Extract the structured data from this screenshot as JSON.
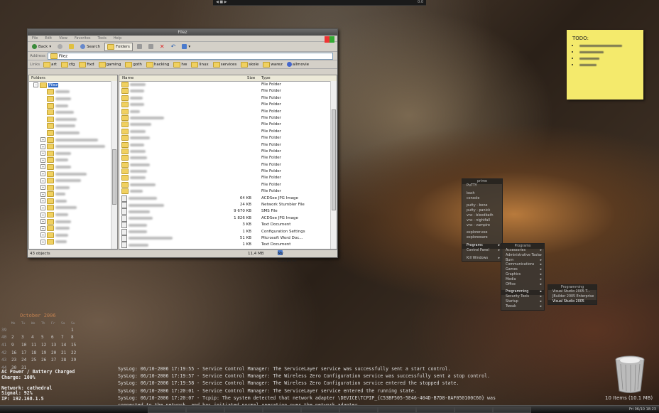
{
  "topbar": {
    "left_text": "",
    "right_text": "0:0"
  },
  "window": {
    "title": "Filez",
    "menu": [
      "File",
      "Edit",
      "View",
      "Favorites",
      "Tools",
      "Help"
    ],
    "toolbar": {
      "back": "Back",
      "search": "Search",
      "folders": "Folders"
    },
    "address_label": "Address",
    "address_value": "Filez",
    "links_label": "Links",
    "links": [
      "art",
      "cfg",
      "fixd",
      "gaming",
      "goth",
      "hacking",
      "hw",
      "linux",
      "services",
      "skole",
      "warez",
      "allmovie"
    ],
    "folders_header": "Folders",
    "tree_root": "Filez",
    "columns": {
      "name": "Name",
      "size": "Size",
      "type": "Type"
    },
    "files": [
      {
        "size": "",
        "type": "File Folder"
      },
      {
        "size": "",
        "type": "File Folder"
      },
      {
        "size": "",
        "type": "File Folder"
      },
      {
        "size": "",
        "type": "File Folder"
      },
      {
        "size": "",
        "type": "File Folder"
      },
      {
        "size": "",
        "type": "File Folder"
      },
      {
        "size": "",
        "type": "File Folder"
      },
      {
        "size": "",
        "type": "File Folder"
      },
      {
        "size": "",
        "type": "File Folder"
      },
      {
        "size": "",
        "type": "File Folder"
      },
      {
        "size": "",
        "type": "File Folder"
      },
      {
        "size": "",
        "type": "File Folder"
      },
      {
        "size": "",
        "type": "File Folder"
      },
      {
        "size": "",
        "type": "File Folder"
      },
      {
        "size": "",
        "type": "File Folder"
      },
      {
        "size": "",
        "type": "File Folder"
      },
      {
        "size": "",
        "type": "File Folder"
      },
      {
        "size": "64 KB",
        "type": "ACDSee JPG Image"
      },
      {
        "size": "24 KB",
        "type": "Network Stumbler File"
      },
      {
        "size": "9 670 KB",
        "type": "SMS File"
      },
      {
        "size": "1 826 KB",
        "type": "ACDSee JPG Image"
      },
      {
        "size": "3 KB",
        "type": "Text Document"
      },
      {
        "size": "1 KB",
        "type": "Configuration Settings"
      },
      {
        "size": "51 KB",
        "type": "Microsoft Word Doc..."
      },
      {
        "size": "1 KB",
        "type": "Text Document"
      }
    ],
    "status": {
      "objects": "43 objects",
      "size": "11,4 MB",
      "location": "My Computer"
    }
  },
  "sticky": {
    "title": "TODO:"
  },
  "menu1": {
    "header": "prime",
    "items": [
      "PuTTY",
      "",
      "bash",
      "console",
      "",
      "putty - bone",
      "putty - panick",
      "vnc - bloodbath",
      "vnc - nightfall",
      "vnc - vampire",
      "",
      "explorer.exe",
      "exploreware",
      "",
      "Programs",
      "Control Panel",
      "",
      "Kill Windows"
    ]
  },
  "menu2": {
    "header": "Programs",
    "items": [
      "Accessories",
      "Administrative Tools",
      "Burn",
      "Communications",
      "Games",
      "Graphics",
      "Media",
      "Office",
      "",
      "Programming",
      "Security Tools",
      "Startup",
      "Tweak"
    ]
  },
  "menu3": {
    "header": "Programming",
    "items": [
      "Visual Studio 2005 T...",
      "JBuilder 2005 Enterprise",
      "Visual Studio 2005"
    ]
  },
  "calendar": {
    "title": "October 2006",
    "days": [
      "Mo",
      "Tu",
      "We",
      "Th",
      "Fr",
      "Sa",
      "Su"
    ],
    "weeks": [
      [
        "39",
        "",
        "",
        "",
        "",
        "",
        "",
        "1"
      ],
      [
        "40",
        "2",
        "3",
        "4",
        "5",
        "6",
        "7",
        "8"
      ],
      [
        "41",
        "9",
        "10",
        "11",
        "12",
        "13",
        "14",
        "15"
      ],
      [
        "42",
        "16",
        "17",
        "18",
        "19",
        "20",
        "21",
        "22"
      ],
      [
        "43",
        "23",
        "24",
        "25",
        "26",
        "27",
        "28",
        "29"
      ],
      [
        "44",
        "30",
        "31",
        "",
        "",
        "",
        "",
        ""
      ]
    ]
  },
  "sysinfo": [
    "AC Power / Battery Charged",
    "Charge: 100%",
    "",
    "Network: cathedral",
    "Signal: 92%",
    "IP: 192.168.1.5"
  ],
  "syslog": [
    "SysLog: 06/10-2006 17:19:55 - Service Control Manager: The ServiceLayer service was successfully sent a start control.",
    "SysLog: 06/10-2006 17:19:57 - Service Control Manager: The Wireless Zero Configuration service was successfully sent a stop control.",
    "SysLog: 06/10-2006 17:19:58 - Service Control Manager: The Wireless Zero Configuration service entered the stopped state.",
    "SysLog: 06/10-2006 17:20:01 - Service Control Manager: The ServiceLayer service entered the running state.",
    "SysLog: 06/10-2006 17:20:07 - Tcpip: The system detected that network adapter \\DEVICE\\TCPIP_{C53BF505-5E46-404D-B7D8-8AF050100C60} was",
    "connected to the network, and has initiated normal operation over the network adapter."
  ],
  "trash": {
    "label": "10 Items (10.1 MB)"
  },
  "taskbar": {
    "clock": "Fri 06/10 18:23"
  }
}
